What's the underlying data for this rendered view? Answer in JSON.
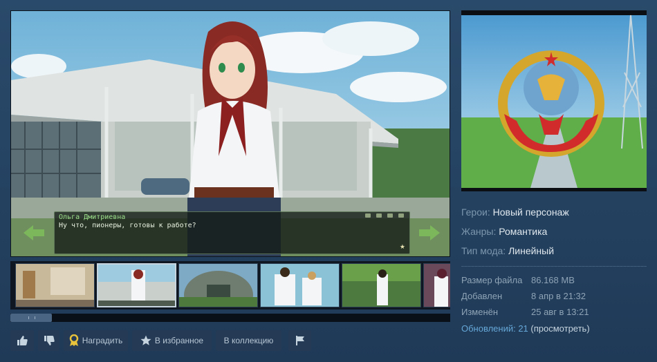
{
  "dialog": {
    "speaker": "Ольга Дмитриевна",
    "text": "Ну что, пионеры, готовы к работе?"
  },
  "info": {
    "heroes_label": "Герои:",
    "heroes_value": "Новый персонаж",
    "genres_label": "Жанры:",
    "genres_value": "Романтика",
    "type_label": "Тип мода:",
    "type_value": "Линейный"
  },
  "meta": {
    "size_label": "Размер файла",
    "size_value": "86.168 MB",
    "added_label": "Добавлен",
    "added_value": "8 апр в 21:32",
    "changed_label": "Изменён",
    "changed_value": "25 авг в 13:21"
  },
  "updates": {
    "link": "Обновлений: 21",
    "view": "(просмотреть)"
  },
  "buttons": {
    "award": "Наградить",
    "favorite": "В избранное",
    "collection": "В коллекцию"
  },
  "thumbnails": [
    "corridor",
    "building-girl",
    "hangar",
    "boys",
    "forest-girl",
    "girl-partial"
  ],
  "icons": {
    "thumbs_up": "thumbs-up-icon",
    "thumbs_down": "thumbs-down-icon",
    "award": "award-icon",
    "star": "star-icon",
    "flag": "flag-icon"
  },
  "colors": {
    "background": "#2a4a6b",
    "button": "#243a55",
    "link": "#66a8d8",
    "label": "#7b96ad"
  }
}
